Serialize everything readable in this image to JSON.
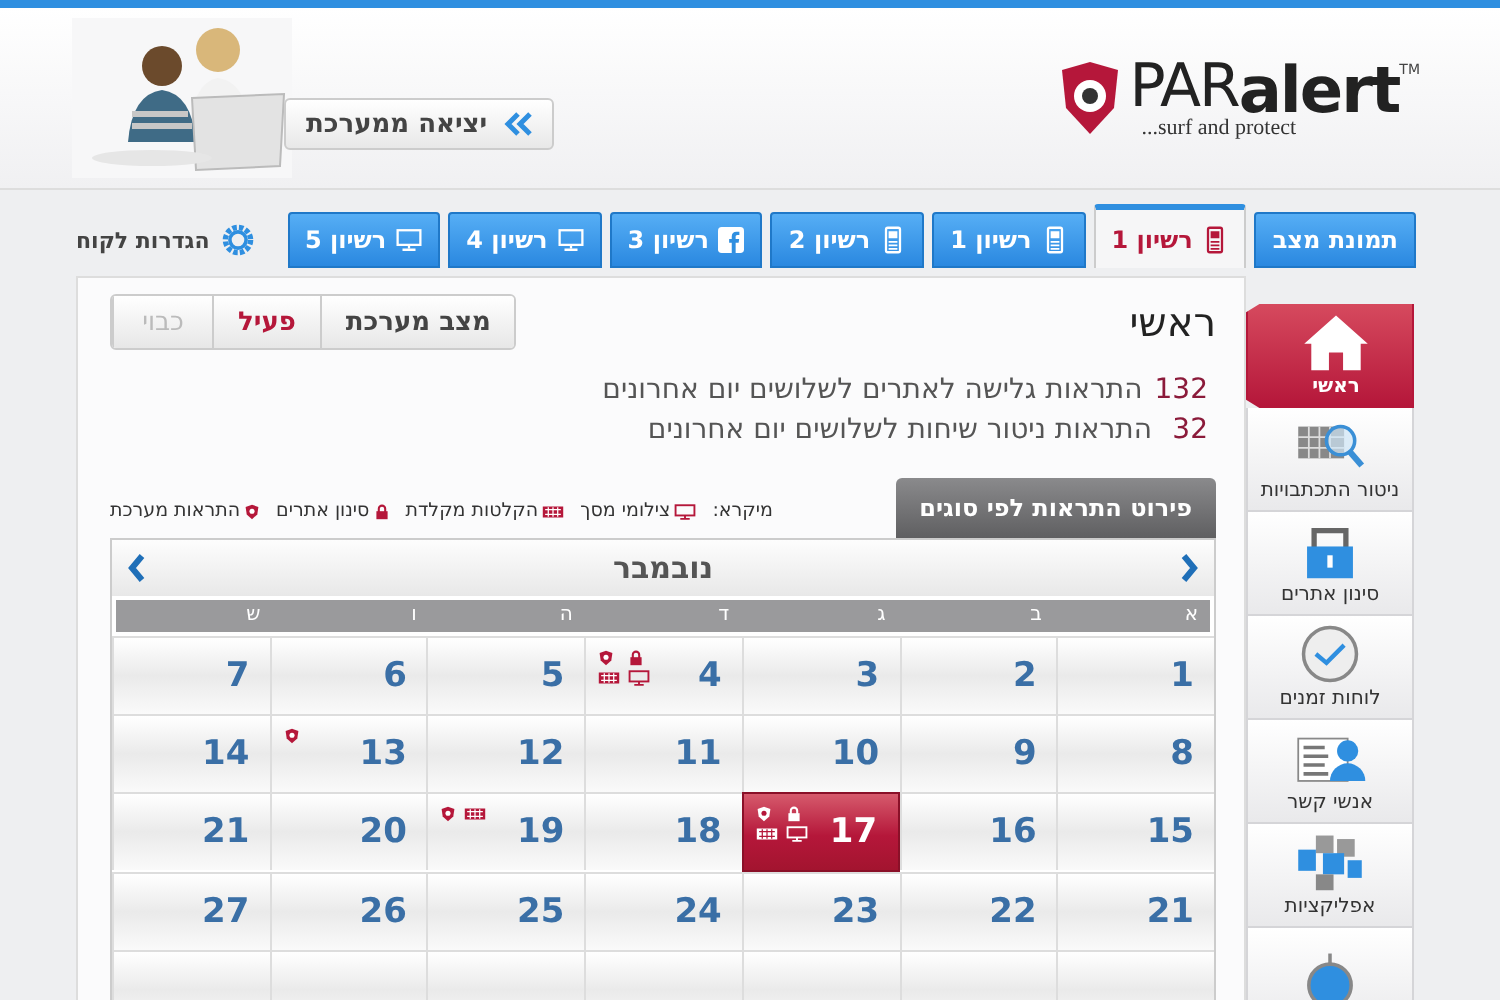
{
  "header": {
    "logo": {
      "brand_light": "PAR",
      "brand_bold": "alert",
      "tm": "TM",
      "tagline": "...surf and protect"
    },
    "exit_button": "יציאה ממערכת"
  },
  "tabs": [
    {
      "label": "תמונת מצב",
      "selected": false
    },
    {
      "label": "רשיון 1",
      "kind": "phone",
      "selected": true
    },
    {
      "label": "רשיון 1",
      "kind": "phone",
      "selected": false
    },
    {
      "label": "רשיון 2",
      "kind": "phone",
      "selected": false
    },
    {
      "label": "רשיון 3",
      "kind": "facebook",
      "selected": false
    },
    {
      "label": "רשיון 4",
      "kind": "monitor",
      "selected": false
    },
    {
      "label": "רשיון 5",
      "kind": "monitor",
      "selected": false
    }
  ],
  "settings_link": "הגדרות לקוח",
  "sidebar": {
    "items": [
      {
        "label": "ראשי",
        "kind": "home",
        "selected": true
      },
      {
        "label": "ניטור התכתבויות",
        "kind": "search",
        "selected": false
      },
      {
        "label": "סינון אתרים",
        "kind": "lock",
        "selected": false
      },
      {
        "label": "לוחות זמנים",
        "kind": "clock",
        "selected": false
      },
      {
        "label": "אנשי קשר",
        "kind": "contacts",
        "selected": false
      },
      {
        "label": "אפליקציות",
        "kind": "apps",
        "selected": false
      },
      {
        "kind": "target",
        "selected": false
      }
    ]
  },
  "page_title": "ראשי",
  "system_status": {
    "label": "מצב מערכת",
    "options": [
      {
        "label": "פעיל",
        "selected": true
      },
      {
        "label": "כבוי",
        "selected": false
      }
    ]
  },
  "summary": [
    {
      "count": "132",
      "text": "התראות גלישה לאתרים לשלושים יום אחרונים"
    },
    {
      "count": "32",
      "text": "התראות ניטור שיחות לשלושים יום אחרונים"
    }
  ],
  "breakdown_tab": "פירוט התראות לפי סוגים",
  "legend": {
    "title": "מיקרא:",
    "items": [
      {
        "kind": "screen",
        "label": "צילומי מסך"
      },
      {
        "kind": "keyboard",
        "label": "הקלטות מקלדת"
      },
      {
        "kind": "lock",
        "label": "סינון אתרים"
      },
      {
        "kind": "shield",
        "label": "התראות מערכת"
      }
    ]
  },
  "calendar": {
    "month": "נובמבר",
    "weekdays": [
      "א",
      "ב",
      "ג",
      "ד",
      "ה",
      "ו",
      "ש"
    ],
    "weeks": [
      [
        {
          "day": "1",
          "selected": false
        },
        {
          "day": "2",
          "selected": false
        },
        {
          "day": "3",
          "selected": false
        },
        {
          "day": "4",
          "selected": false,
          "alerts": [
            {
              "kind": "shield"
            },
            {
              "kind": "lock"
            },
            {
              "kind": "keyboard"
            },
            {
              "kind": "screen"
            }
          ]
        },
        {
          "day": "5",
          "selected": false
        },
        {
          "day": "6",
          "selected": false
        },
        {
          "day": "7",
          "selected": false
        }
      ],
      [
        {
          "day": "8",
          "selected": false
        },
        {
          "day": "9",
          "selected": false
        },
        {
          "day": "10",
          "selected": false
        },
        {
          "day": "11",
          "selected": false
        },
        {
          "day": "12",
          "selected": false
        },
        {
          "day": "13",
          "selected": false,
          "alerts": [
            {
              "kind": "shield"
            }
          ]
        },
        {
          "day": "14",
          "selected": false
        }
      ],
      [
        {
          "day": "15",
          "selected": false
        },
        {
          "day": "16",
          "selected": false
        },
        {
          "day": "17",
          "selected": true,
          "alerts": [
            {
              "kind": "shield"
            },
            {
              "kind": "lock"
            },
            {
              "kind": "keyboard"
            },
            {
              "kind": "screen"
            }
          ]
        },
        {
          "day": "18",
          "selected": false
        },
        {
          "day": "19",
          "selected": false,
          "alerts": [
            {
              "kind": "shield"
            },
            {
              "kind": "keyboard"
            }
          ]
        },
        {
          "day": "20",
          "selected": false
        },
        {
          "day": "21",
          "selected": false
        }
      ],
      [
        {
          "day": "21",
          "selected": false
        },
        {
          "day": "22",
          "selected": false
        },
        {
          "day": "23",
          "selected": false
        },
        {
          "day": "24",
          "selected": false
        },
        {
          "day": "25",
          "selected": false
        },
        {
          "day": "26",
          "selected": false
        },
        {
          "day": "27",
          "selected": false
        }
      ],
      [
        {
          "selected": false
        },
        {
          "selected": false
        },
        {
          "selected": false
        },
        {
          "selected": false
        },
        {
          "selected": false
        },
        {
          "selected": false
        },
        {
          "selected": false
        }
      ]
    ]
  }
}
